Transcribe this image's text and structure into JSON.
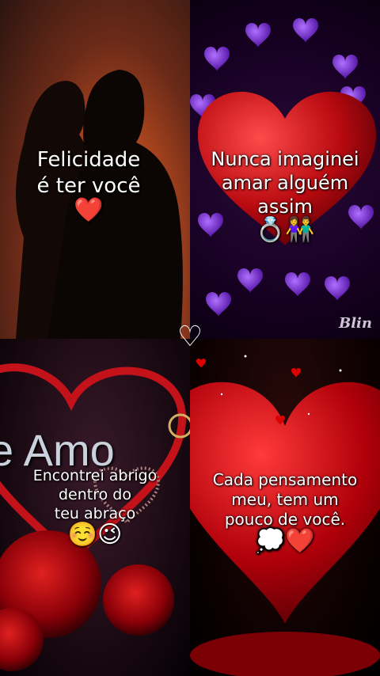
{
  "panels": {
    "top_left": {
      "line1": "Felicidade",
      "line2": "é ter você",
      "emoji": "❤️"
    },
    "top_right": {
      "line1": "Nunca imaginei",
      "line2": "amar alguém",
      "line3": "assim",
      "emoji": "💍👫"
    },
    "bottom_left": {
      "banner": "e Amo",
      "line1": "Encontrei abrigo",
      "line2": "dentro do",
      "line3": "teu abraço",
      "emoji": "☺️😉"
    },
    "bottom_right": {
      "line1": "Cada pensamento",
      "line2": "meu, tem um",
      "line3": "pouco de você.",
      "emoji": "💭❤️"
    }
  },
  "divider_symbol": "♡",
  "watermark": "Blin"
}
